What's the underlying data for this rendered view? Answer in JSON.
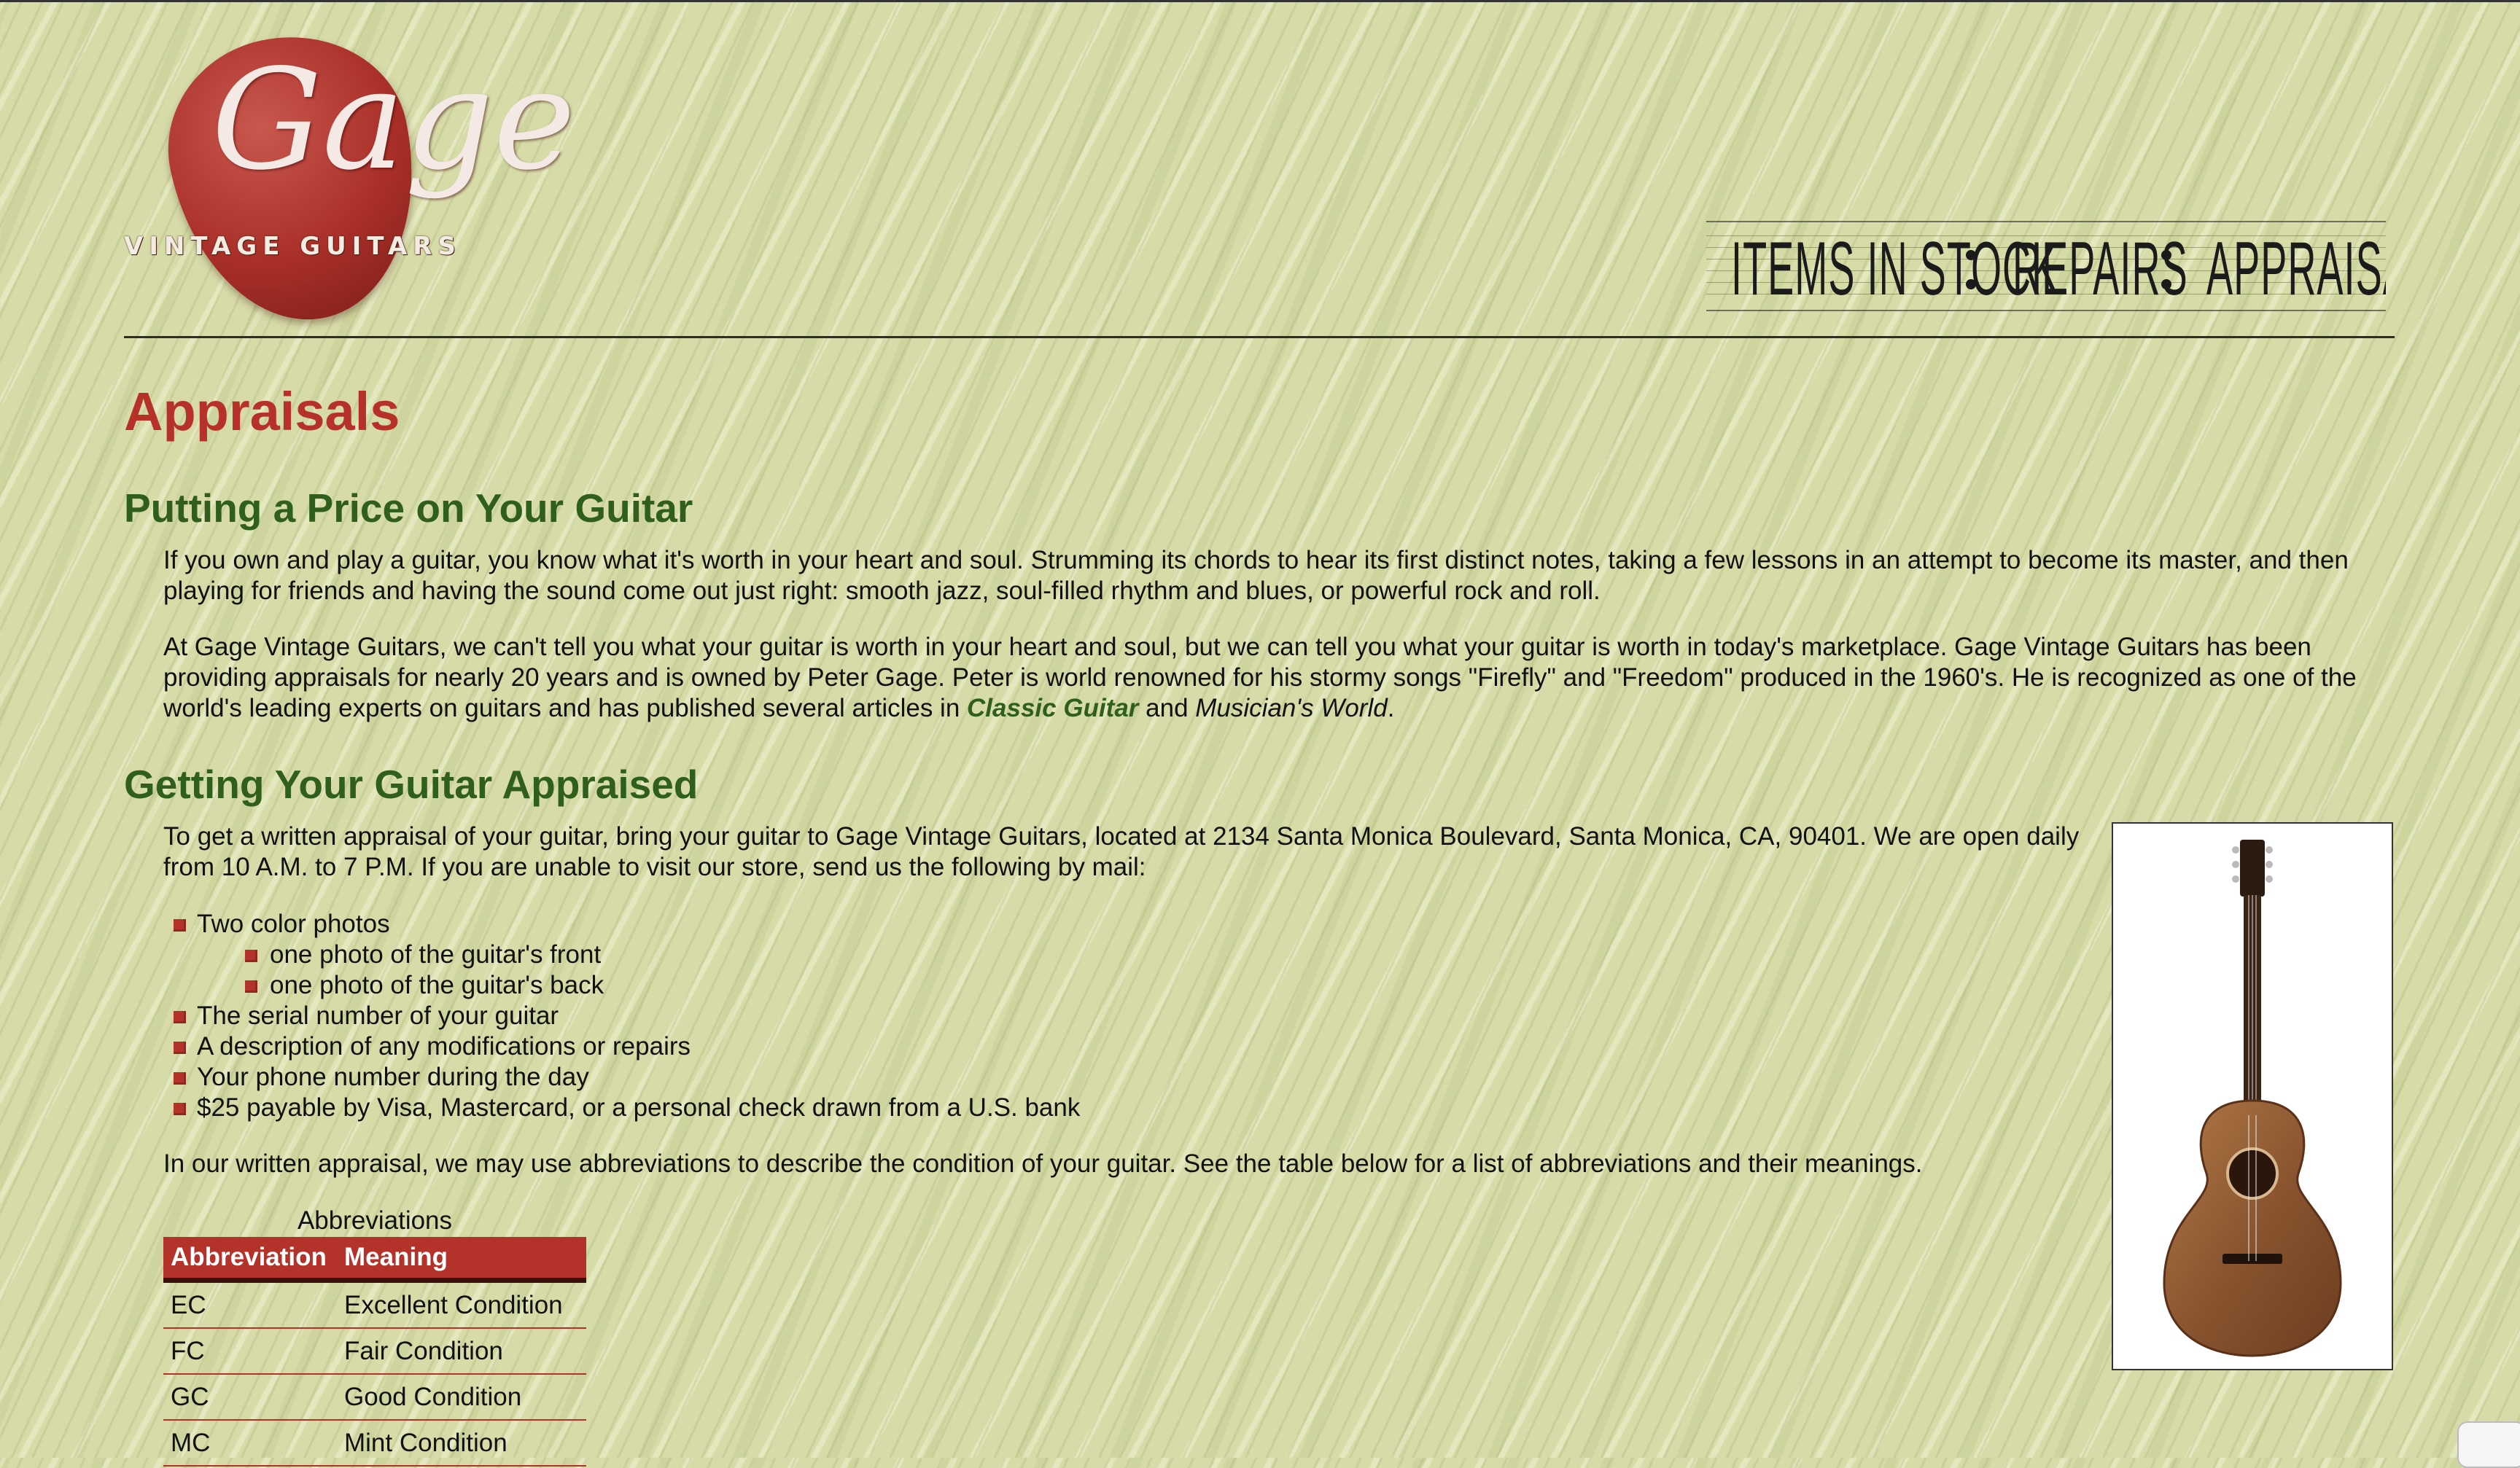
{
  "logo": {
    "script": "Gage",
    "brand": "VINTAGE GUITARS"
  },
  "nav": [
    {
      "label": "ITEMS IN STOCK"
    },
    {
      "label": "REPAIRS"
    },
    {
      "label": "APPRAISALS"
    }
  ],
  "page_title": "Appraisals",
  "section1": {
    "heading": "Putting a Price on Your Guitar",
    "p1": "If you own and play a guitar, you know what it's worth in your heart and soul. Strumming its chords to hear its first distinct notes, taking a few lessons in an attempt to become its master, and then playing for friends and having the sound come out just right: smooth jazz, soul-filled rhythm and blues, or powerful rock and roll.",
    "p2_a": "At Gage Vintage Guitars, we can't tell you what your guitar is worth in your heart and soul, but we can tell you what your guitar is worth in today's marketplace. Gage Vintage Guitars has been providing appraisals for nearly 20 years and is owned by Peter Gage. Peter is world renowned for his stormy songs \"Firefly\" and \"Freedom\" produced in the 1960's. He is recognized as one of the world's leading experts on guitars and has published several articles in ",
    "p2_link": "Classic Guitar",
    "p2_b": " and ",
    "p2_italic": "Musician's World",
    "p2_end": "."
  },
  "section2": {
    "heading": "Getting Your Guitar Appraised",
    "p3": "To get a written appraisal of your guitar, bring your guitar to Gage Vintage Guitars, located at 2134 Santa Monica Boulevard, Santa Monica, CA, 90401. We are open daily from 10 A.M. to 7 P.M. If you are unable to visit our store, send us the following by mail:",
    "list": [
      "Two color photos",
      "one photo of the guitar's front",
      "one photo of the guitar's back",
      "The serial number of your guitar",
      "A description of any modifications or repairs",
      "Your phone number during the day",
      "$25 payable by Visa, Mastercard, or a personal check drawn from a U.S. bank"
    ],
    "p4": "In our written appraisal, we may use abbreviations to describe the condition of your guitar. See the table below for a list of abbreviations and their meanings."
  },
  "table": {
    "caption": "Abbreviations",
    "headers": [
      "Abbreviation",
      "Meaning"
    ],
    "rows": [
      [
        "EC",
        "Excellent Condition"
      ],
      [
        "FC",
        "Fair Condition"
      ],
      [
        "GC",
        "Good Condition"
      ],
      [
        "MC",
        "Mint Condition"
      ]
    ]
  },
  "colors": {
    "accent_red": "#b3322a",
    "heading_green": "#2f5f1b",
    "background": "#d6dba8"
  }
}
